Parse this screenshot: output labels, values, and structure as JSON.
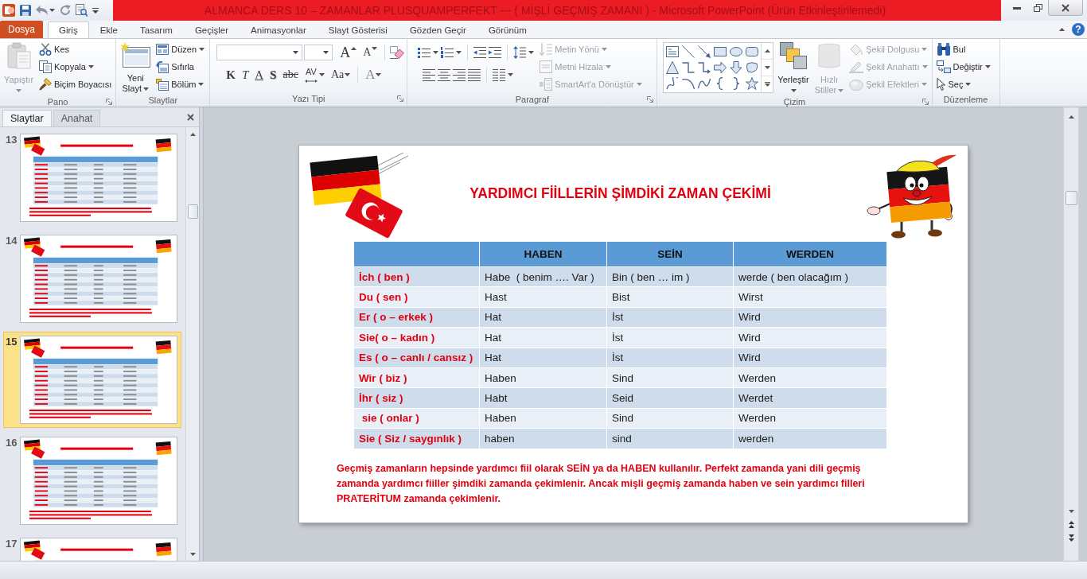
{
  "window": {
    "title": "ALMANCA DERS 10 – ZAMANLAR PLUSQUAMPERFEKT --- ( MİŞLİ GEÇMİŞ ZAMANI ) - Microsoft PowerPoint (Ürün Etkinleştirilemedi)"
  },
  "tabs": [
    {
      "label": "Dosya",
      "kind": "file",
      "selected": false
    },
    {
      "label": "Giriş",
      "kind": "tab",
      "selected": true
    },
    {
      "label": "Ekle",
      "kind": "tab",
      "selected": false
    },
    {
      "label": "Tasarım",
      "kind": "tab",
      "selected": false
    },
    {
      "label": "Geçişler",
      "kind": "tab",
      "selected": false
    },
    {
      "label": "Animasyonlar",
      "kind": "tab",
      "selected": false
    },
    {
      "label": "Slayt Gösterisi",
      "kind": "tab",
      "selected": false
    },
    {
      "label": "Gözden Geçir",
      "kind": "tab",
      "selected": false
    },
    {
      "label": "Görünüm",
      "kind": "tab",
      "selected": false
    }
  ],
  "help": "?",
  "ribbon": {
    "clipboard": {
      "label": "Pano",
      "launcher": true,
      "paste": {
        "lines": [
          "Yapıştır"
        ],
        "dropdown": true,
        "disabled": true
      },
      "commands": [
        {
          "label": "Kes",
          "dropdown": false
        },
        {
          "label": "Kopyala",
          "dropdown": true
        },
        {
          "label": "Biçim Boyacısı",
          "dropdown": false
        }
      ]
    },
    "slides": {
      "label": "Slaytlar",
      "new_slide": {
        "lines": [
          "Yeni",
          "Slayt"
        ],
        "dropdown": true,
        "disabled": false
      },
      "commands": [
        {
          "label": "Düzen",
          "dropdown": true
        },
        {
          "label": "Sıfırla",
          "dropdown": false
        },
        {
          "label": "Bölüm",
          "dropdown": true
        }
      ]
    },
    "font": {
      "label": "Yazı Tipi",
      "launcher": true,
      "size_buttons": [
        {
          "label": "A",
          "kind": "grow"
        },
        {
          "label": "A",
          "kind": "shrink"
        }
      ],
      "format_buttons": [
        {
          "label": "K",
          "kind": "bold",
          "dropdown": false
        },
        {
          "label": "T",
          "kind": "italic",
          "dropdown": false
        },
        {
          "label": "A",
          "kind": "underline",
          "dropdown": false
        },
        {
          "label": "S",
          "kind": "shadow",
          "dropdown": false
        },
        {
          "label": "abc",
          "kind": "strikethrough",
          "dropdown": false
        },
        {
          "label": "AV",
          "kind": "spacing",
          "dropdown": true
        },
        {
          "label": "Aa",
          "kind": "case",
          "dropdown": true
        },
        {
          "label": "A",
          "kind": "color",
          "dropdown": true
        }
      ]
    },
    "paragraph": {
      "label": "Paragraf",
      "launcher": true,
      "commands": [
        {
          "label": "Metin Yönü",
          "dropdown": true,
          "disabled": true
        },
        {
          "label": "Metni Hizala",
          "dropdown": true,
          "disabled": true
        },
        {
          "label": "SmartArt'a Dönüştür",
          "dropdown": true,
          "disabled": true
        }
      ]
    },
    "drawing": {
      "label": "Çizim",
      "launcher": true,
      "arrange": {
        "lines": [
          "Yerleştir"
        ],
        "dropdown": true,
        "disabled": false
      },
      "quick_styles": {
        "lines": [
          "Hızlı",
          "Stiller"
        ],
        "dropdown": true,
        "disabled": true
      },
      "commands": [
        {
          "label": "Şekil Dolgusu",
          "dropdown": true,
          "disabled": true
        },
        {
          "label": "Şekil Anahattı",
          "dropdown": true,
          "disabled": true
        },
        {
          "label": "Şekil Efektleri",
          "dropdown": true,
          "disabled": true
        }
      ]
    },
    "editing": {
      "label": "Düzenleme",
      "commands": [
        {
          "label": "Bul",
          "dropdown": false
        },
        {
          "label": "Değiştir",
          "dropdown": true
        },
        {
          "label": "Seç",
          "dropdown": true
        }
      ]
    }
  },
  "slide_pane": {
    "tabs": [
      {
        "label": "Slaytlar",
        "selected": true
      },
      {
        "label": "Anahat",
        "selected": false
      }
    ],
    "slides": [
      {
        "number": "13",
        "selected": false
      },
      {
        "number": "14",
        "selected": false
      },
      {
        "number": "15",
        "selected": true
      },
      {
        "number": "16",
        "selected": false
      },
      {
        "number": "17",
        "selected": false
      }
    ]
  },
  "slide": {
    "title": "YARDIMCI FİİLLERİN ŞİMDİKİ ZAMAN ÇEKİMİ",
    "table": {
      "columns": [
        "",
        "HABEN",
        "SEİN",
        "WERDEN"
      ],
      "rows": [
        [
          "İch ( ben )",
          "Habe  ( benim …. Var )",
          "Bin ( ben … im )",
          "werde ( ben olacağım )"
        ],
        [
          "Du ( sen )",
          "Hast",
          "Bist",
          "Wirst"
        ],
        [
          "Er ( o – erkek )",
          "Hat",
          "İst",
          "Wird"
        ],
        [
          "Sie( o – kadın )",
          "Hat",
          "İst",
          "Wird"
        ],
        [
          "Es ( o – canlı / cansız )",
          "Hat",
          "İst",
          "Wird"
        ],
        [
          "Wir ( biz )",
          "Haben",
          "Sind",
          "Werden"
        ],
        [
          "İhr ( siz )",
          "Habt",
          "Seid",
          "Werdet"
        ],
        [
          " sie ( onlar )",
          "Haben",
          "Sind",
          "Werden"
        ],
        [
          "Sie ( Siz / saygınlık )",
          "haben",
          "sind",
          "werden"
        ]
      ]
    },
    "note": "Geçmiş zamanların hepsinde yardımcı fiil olarak SEİN ya da HABEN kullanılır. Perfekt zamanda yani dili geçmiş zamanda yardımcı fiiller şimdiki zamanda çekimlenir. Ancak mişli geçmiş zamanda haben ve sein yardımcı filleri PRATERİTUM zamanda çekimlenir."
  }
}
